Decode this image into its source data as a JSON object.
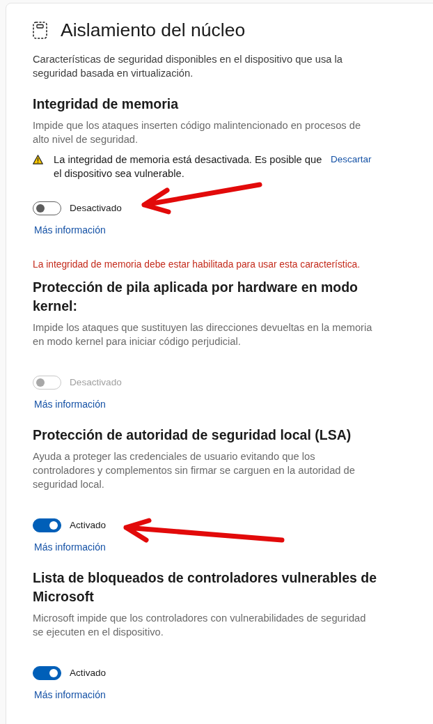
{
  "header": {
    "title": "Aislamiento del núcleo",
    "description": "Características de seguridad disponibles en el dispositivo que usa la seguridad basada en virtualización."
  },
  "features": [
    {
      "heading": "Integridad de memoria",
      "description": "Impide que los ataques inserten código malintencionado en procesos de alto nivel de seguridad.",
      "warning": {
        "text": "La integridad de memoria está desactivada. Es posible que el dispositivo sea vulnerable.",
        "dismiss": "Descartar"
      },
      "toggle": {
        "on": false,
        "disabled": false,
        "label": "Desactivado"
      },
      "arrow": {
        "kind": "downward"
      },
      "link": "Más información"
    },
    {
      "notice": "La integridad de memoria debe estar habilitada para usar esta característica.",
      "heading": "Protección de pila aplicada por hardware en modo kernel:",
      "description": "Impide los ataques que sustituyen las direcciones devueltas en la memoria en modo kernel para iniciar código perjudicial.",
      "toggle": {
        "on": false,
        "disabled": true,
        "label": "Desactivado"
      },
      "link": "Más información"
    },
    {
      "heading": "Protección de autoridad de seguridad local (LSA)",
      "description": "Ayuda a proteger las credenciales de usuario evitando que los controladores y complementos sin firmar se carguen en la autoridad de seguridad local.",
      "toggle": {
        "on": true,
        "disabled": false,
        "label": "Activado"
      },
      "arrow": {
        "kind": "upward"
      },
      "link": "Más información"
    },
    {
      "heading": "Lista de bloqueados de controladores vulnerables de Microsoft",
      "description": "Microsoft impide que los controladores con vulnerabilidades de seguridad se ejecuten en el dispositivo.",
      "toggle": {
        "on": true,
        "disabled": false,
        "label": "Activado"
      },
      "link": "Más información"
    }
  ]
}
